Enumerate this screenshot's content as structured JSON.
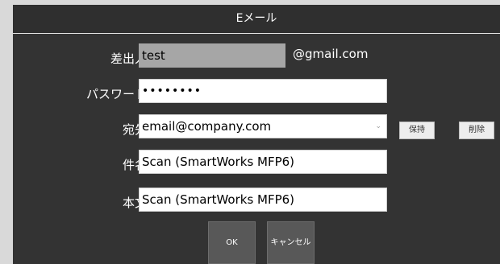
{
  "dialog": {
    "title": "Eメール"
  },
  "form": {
    "sender": {
      "label": "差出人",
      "value": "test",
      "suffix": "@gmail.com"
    },
    "password": {
      "label": "パスワード",
      "value": "••••••••"
    },
    "destination": {
      "label": "宛先",
      "value": "email@company.com",
      "dropdown_icon": "chevron-down-icon"
    },
    "subject": {
      "label": "件名",
      "value": "Scan (SmartWorks MFP6)"
    },
    "body": {
      "label": "本文",
      "value": "Scan (SmartWorks MFP6)"
    }
  },
  "buttons": {
    "save": "保持",
    "delete": "削除",
    "ok": "OK",
    "cancel": "キャンセル"
  },
  "colors": {
    "dialog_bg": "#333333",
    "field_bg": "#ffffff",
    "readonly_bg": "#a6a6a6",
    "button_bg": "#585858"
  }
}
